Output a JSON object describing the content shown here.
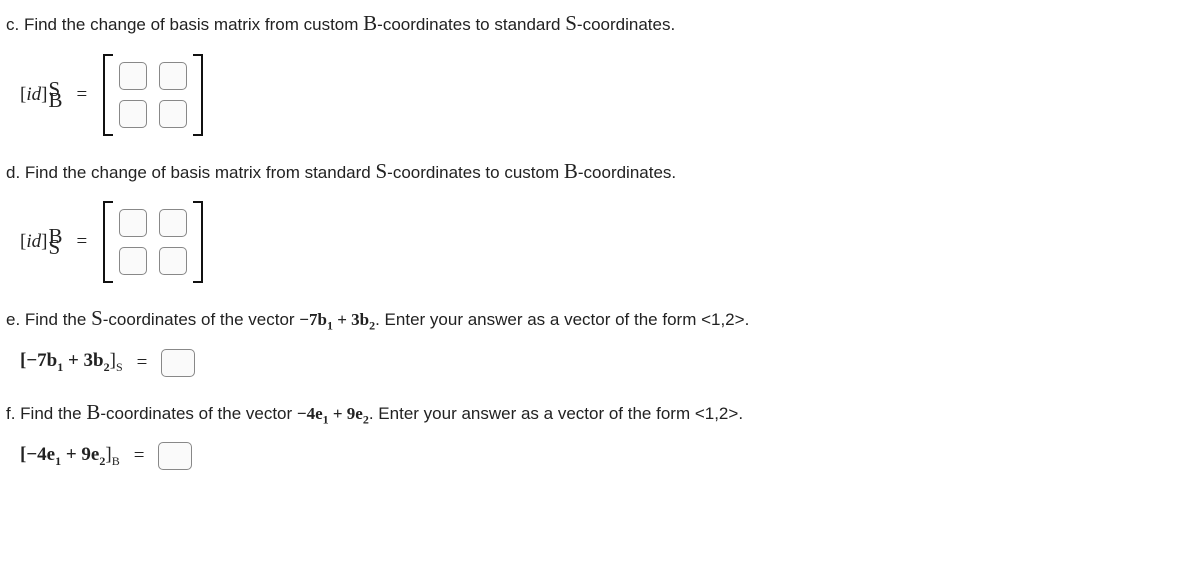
{
  "c": {
    "text_pre": "c. Find the change of basis matrix from custom ",
    "text_mid": "-coordinates to standard ",
    "text_post": "-coordinates.",
    "lhs_id": "id",
    "sup": "S",
    "sub": "B",
    "eq": "="
  },
  "d": {
    "text_pre": "d. Find the change of basis matrix from standard ",
    "text_mid": "-coordinates to custom ",
    "text_post": "-coordinates.",
    "lhs_id": "id",
    "sup": "B",
    "sub": "S",
    "eq": "="
  },
  "e": {
    "text1": "e. Find the ",
    "text2": "-coordinates of the vector ",
    "expr_main": "−7b",
    "expr_sub1": "1",
    "expr_plus": " + 3b",
    "expr_sub2": "2",
    "text3": ". Enter your answer as a vector of the form <1,2>.",
    "lhs_open": "[−7b",
    "lhs_s1": "1",
    "lhs_plus": " + 3b",
    "lhs_s2": "2",
    "lhs_close": "]",
    "lhs_sub": "S",
    "eq": "="
  },
  "f": {
    "text1": "f. Find the ",
    "text2": "-coordinates of the vector ",
    "expr_main": "−4e",
    "expr_sub1": "1",
    "expr_plus": " + 9e",
    "expr_sub2": "2",
    "text3": ". Enter your answer as a vector of the form <1,2>.",
    "lhs_open": "[−4e",
    "lhs_s1": "1",
    "lhs_plus": " + 9e",
    "lhs_s2": "2",
    "lhs_close": "]",
    "lhs_sub": "B",
    "eq": "="
  },
  "sym": {
    "B": "B",
    "S": "S"
  }
}
